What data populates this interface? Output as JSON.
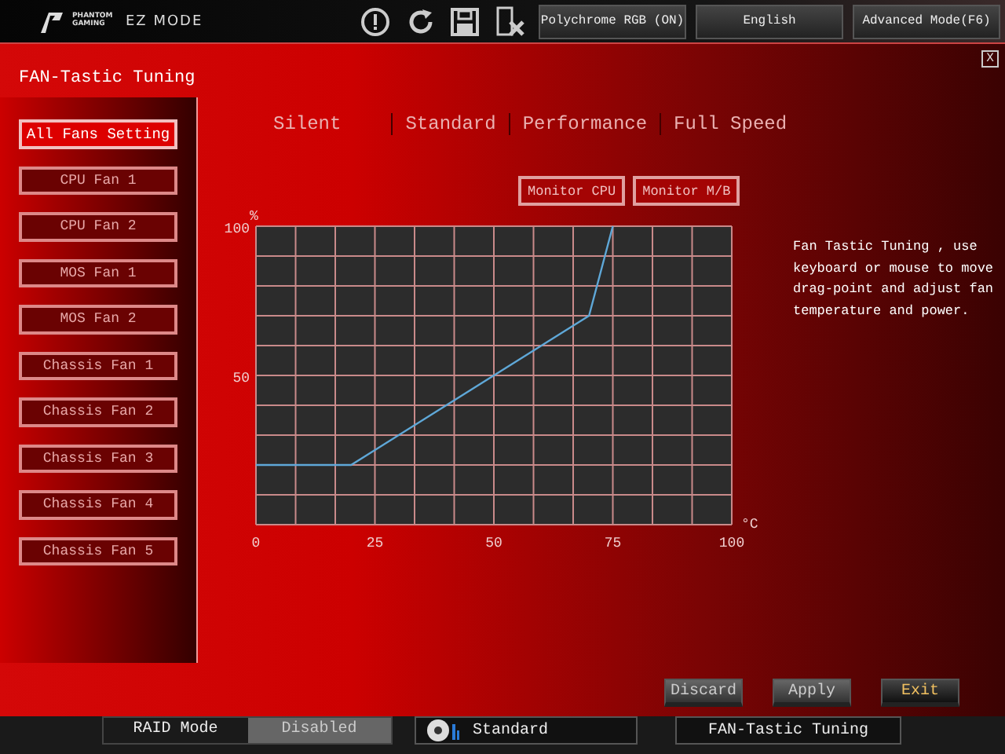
{
  "top_bar": {
    "brand": "PHANTOM GAMING",
    "mode": "EZ MODE",
    "buttons": [
      {
        "label": "Polychrome RGB (ON)"
      },
      {
        "label": "English"
      },
      {
        "label": "Advanced Mode(F6)"
      }
    ]
  },
  "panel": {
    "title": "FAN-Tastic Tuning",
    "close": "X"
  },
  "fans": [
    {
      "label": "All Fans Setting",
      "selected": true
    },
    {
      "label": "CPU Fan 1",
      "selected": false
    },
    {
      "label": "CPU Fan 2",
      "selected": false
    },
    {
      "label": "MOS Fan 1",
      "selected": false
    },
    {
      "label": "MOS Fan 2",
      "selected": false
    },
    {
      "label": "Chassis Fan 1",
      "selected": false
    },
    {
      "label": "Chassis Fan 2",
      "selected": false
    },
    {
      "label": "Chassis Fan 3",
      "selected": false
    },
    {
      "label": "Chassis Fan 4",
      "selected": false
    },
    {
      "label": "Chassis Fan 5",
      "selected": false
    }
  ],
  "modes": [
    {
      "label": "Silent"
    },
    {
      "label": "Standard"
    },
    {
      "label": "Performance"
    },
    {
      "label": "Full Speed"
    }
  ],
  "monitors": [
    {
      "label": "Monitor CPU"
    },
    {
      "label": "Monitor M/B"
    }
  ],
  "chart_data": {
    "type": "line",
    "ylabel": "%",
    "xlabel": "°C",
    "x": [
      0,
      20,
      70,
      75
    ],
    "series": [
      {
        "color": "#5fa8d8",
        "values": [
          20,
          20,
          70,
          100
        ]
      }
    ],
    "xlim": [
      0,
      100
    ],
    "ylim": [
      0,
      100
    ],
    "xticks": [
      0,
      25,
      50,
      75,
      100
    ],
    "yticks": [
      50,
      100
    ],
    "grid": true
  },
  "help": "Fan Tastic Tuning , use keyboard or mouse to move drag-point and adjust fan temperature and power.",
  "actions": [
    {
      "label": "Discard",
      "selected": false
    },
    {
      "label": "Apply",
      "selected": false
    },
    {
      "label": "Exit",
      "selected": true
    }
  ],
  "bottom_bar": {
    "raid_label": "RAID Mode",
    "raid_value": "Disabled",
    "fan_mode": "Standard",
    "tuning": "FAN-Tastic Tuning"
  }
}
